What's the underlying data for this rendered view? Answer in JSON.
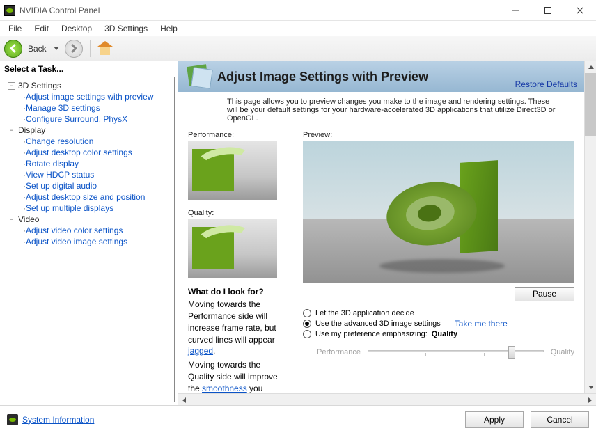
{
  "window": {
    "title": "NVIDIA Control Panel"
  },
  "menu": {
    "file": "File",
    "edit": "Edit",
    "desktop": "Desktop",
    "settings3d": "3D Settings",
    "help": "Help"
  },
  "toolbar": {
    "back": "Back"
  },
  "sidebar": {
    "task_label": "Select a Task...",
    "groups": [
      {
        "name": "3D Settings",
        "items": [
          "Adjust image settings with preview",
          "Manage 3D settings",
          "Configure Surround, PhysX"
        ]
      },
      {
        "name": "Display",
        "items": [
          "Change resolution",
          "Adjust desktop color settings",
          "Rotate display",
          "View HDCP status",
          "Set up digital audio",
          "Adjust desktop size and position",
          "Set up multiple displays"
        ]
      },
      {
        "name": "Video",
        "items": [
          "Adjust video color settings",
          "Adjust video image settings"
        ]
      }
    ]
  },
  "page": {
    "title": "Adjust Image Settings with Preview",
    "restore": "Restore Defaults",
    "description": "This page allows you to preview changes you make to the image and rendering settings. These will be your default settings for your hardware-accelerated 3D applications that utilize Direct3D or OpenGL.",
    "performance_label": "Performance:",
    "quality_label": "Quality:",
    "preview_label": "Preview:",
    "what_head": "What do I look for?",
    "what_body_1a": "Moving towards the Performance side will increase frame rate, but curved lines will appear ",
    "what_body_1b": "jagged",
    "what_body_1c": ".",
    "what_body_2a": "Moving towards the Quality side will improve the ",
    "what_body_2b": "smoothness",
    "what_body_2c": " you",
    "pause": "Pause",
    "radio1": "Let the 3D application decide",
    "radio2": "Use the advanced 3D image settings",
    "take_link": "Take me there",
    "radio3": "Use my preference emphasizing:",
    "radio3_value": "Quality",
    "slider_left": "Performance",
    "slider_right": "Quality"
  },
  "footer": {
    "sysinfo": "System Information",
    "apply": "Apply",
    "cancel": "Cancel"
  }
}
